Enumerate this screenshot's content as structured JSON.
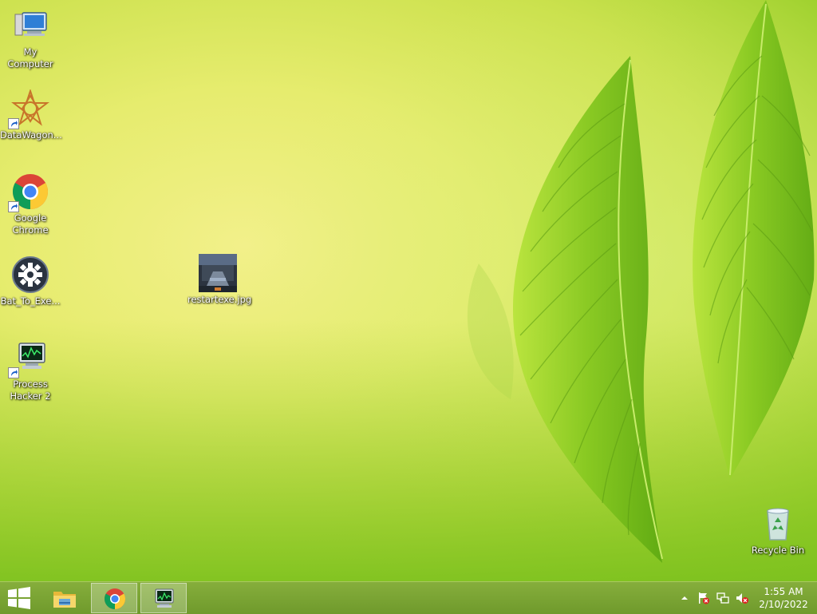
{
  "desktop": {
    "icons": [
      {
        "label": "My Computer",
        "icon": "computer-icon"
      },
      {
        "label": "DataWagon...",
        "icon": "datawagon-icon"
      },
      {
        "label": "Google Chrome",
        "icon": "chrome-icon"
      },
      {
        "label": "Bat_To_Exe...",
        "icon": "gear-icon"
      },
      {
        "label": "Process Hacker 2",
        "icon": "process-hacker-icon"
      },
      {
        "label": "restartexe.jpg",
        "icon": "image-file-icon"
      },
      {
        "label": "Recycle Bin",
        "icon": "recycle-bin-icon"
      }
    ]
  },
  "taskbar": {
    "pinned": [
      {
        "name": "File Explorer",
        "icon": "folder-icon"
      },
      {
        "name": "Google Chrome",
        "icon": "chrome-icon"
      },
      {
        "name": "Process Hacker 2",
        "icon": "process-hacker-icon"
      }
    ],
    "tray": {
      "icons": [
        "show-hidden-icons-arrow",
        "action-center-flag-icon",
        "network-icon",
        "volume-muted-icon"
      ]
    },
    "clock": {
      "time": "1:55 AM",
      "date": "2/10/2022"
    }
  },
  "colors": {
    "taskbar": "#7aa434",
    "wallpaper_light": "#f2f08a",
    "wallpaper_green": "#86c526",
    "leaf": "#7fc41e"
  }
}
